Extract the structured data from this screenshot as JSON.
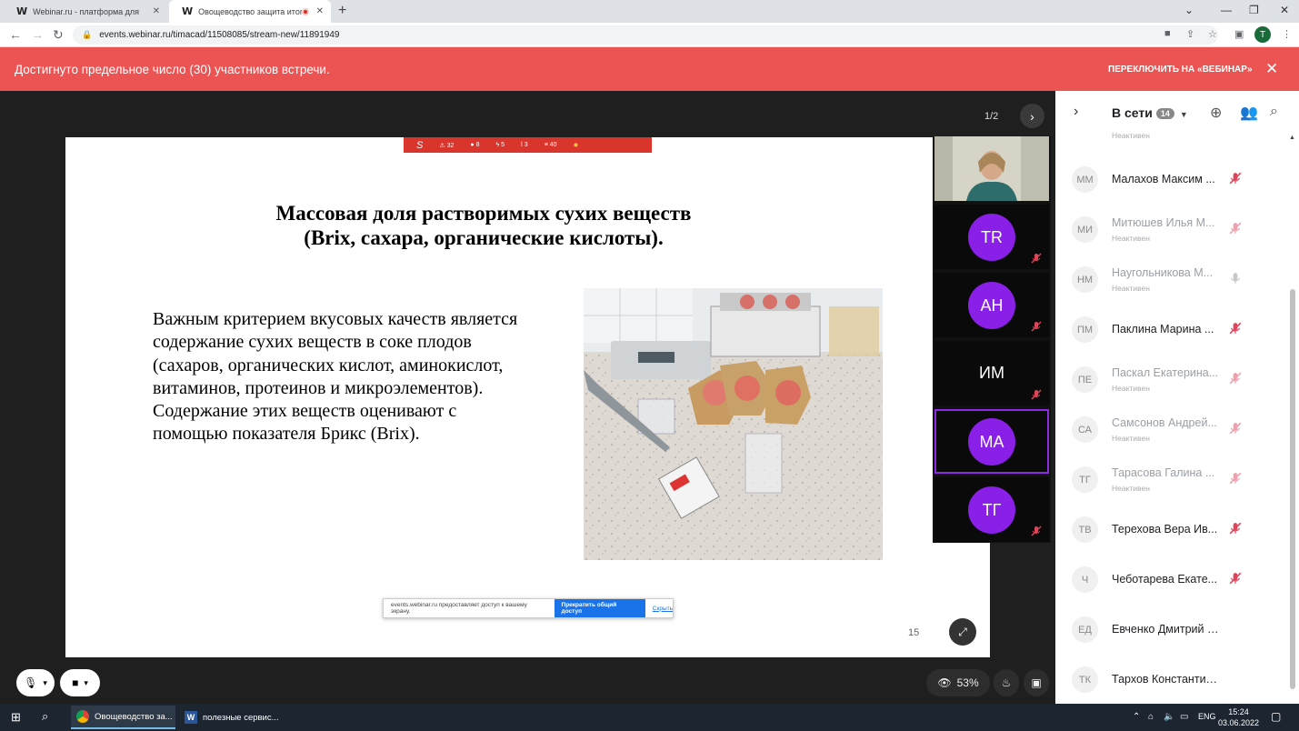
{
  "browser": {
    "tabs": [
      {
        "favicon": "W",
        "title": "Webinar.ru - платформа для пр"
      },
      {
        "favicon": "W",
        "title": "Овощеводство защита итог"
      }
    ],
    "url": "events.webinar.ru/timacad/11508085/stream-new/11891949",
    "profile_initial": "T"
  },
  "banner": {
    "message": "Достигнуто предельное число (30) участников встречи.",
    "switch_label": "ПЕРЕКЛЮЧИТЬ НА «ВЕБИНАР»",
    "color": "#ec5353"
  },
  "viewer": {
    "pager": "1/2",
    "slide_number": "15",
    "strip_stats": [
      "32",
      "8",
      "5",
      "3",
      "40"
    ]
  },
  "slide": {
    "title_line1": "Массовая доля растворимых сухих веществ",
    "title_line2": "(Brix, сахара, органические кислоты).",
    "body": "Важным критерием вкусовых качеств является содержание сухих веществ в соке плодов (сахаров, органических кислот, аминокислот, витаминов, протеинов и микроэлементов). Содержание этих веществ оценивают с помощью показателя Брикс (Brix)."
  },
  "screen_share": {
    "message": "events.webinar.ru предоставляет доступ к вашему экрану.",
    "stop_label": "Прекратить общий доступ",
    "hide_label": "Скрыть"
  },
  "tiles": [
    {
      "initials": "",
      "kind": "video"
    },
    {
      "initials": "TR",
      "kind": "avatar"
    },
    {
      "initials": "АН",
      "kind": "avatar"
    },
    {
      "initials": "ИМ",
      "kind": "plain"
    },
    {
      "initials": "МА",
      "kind": "avatar",
      "active": true
    },
    {
      "initials": "ТГ",
      "kind": "avatar"
    }
  ],
  "bottom_controls": {
    "quality": "53%"
  },
  "panel": {
    "title": "В сети",
    "count": "14",
    "participants": [
      {
        "initials": "ММ",
        "name": "Малахов Максим ...",
        "status": "",
        "mic": "muted"
      },
      {
        "initials": "МИ",
        "name": "Митюшев Илья М...",
        "status": "Неактивен",
        "mic": "muted-faded"
      },
      {
        "initials": "НМ",
        "name": "Наугольникова М...",
        "status": "Неактивен",
        "mic": "on-faded"
      },
      {
        "initials": "ПМ",
        "name": "Паклина Марина ...",
        "status": "",
        "mic": "muted"
      },
      {
        "initials": "ПЕ",
        "name": "Паскал Екатерина...",
        "status": "Неактивен",
        "mic": "muted-faded"
      },
      {
        "initials": "СА",
        "name": "Самсонов Андрей...",
        "status": "Неактивен",
        "mic": "muted-faded"
      },
      {
        "initials": "ТГ",
        "name": "Тарасова Галина ...",
        "status": "Неактивен",
        "mic": "muted-faded"
      },
      {
        "initials": "ТВ",
        "name": "Терехова Вера Ив...",
        "status": "",
        "mic": "muted"
      },
      {
        "initials": "Ч",
        "name": "Чеботарева Екате...",
        "status": "",
        "mic": "muted"
      },
      {
        "initials": "ЕД",
        "name": "Евченко Дмитрий Серг...",
        "status": "",
        "mic": "none"
      },
      {
        "initials": "ТК",
        "name": "Тархов Константин Вик...",
        "status": "",
        "mic": "none"
      }
    ],
    "partial_top_status": "Неактивен"
  },
  "taskbar": {
    "items": [
      {
        "name": "Овощеводство за..."
      },
      {
        "name": "полезные сервис..."
      }
    ],
    "language": "ENG",
    "time": "15:24",
    "date": "03.06.2022"
  }
}
